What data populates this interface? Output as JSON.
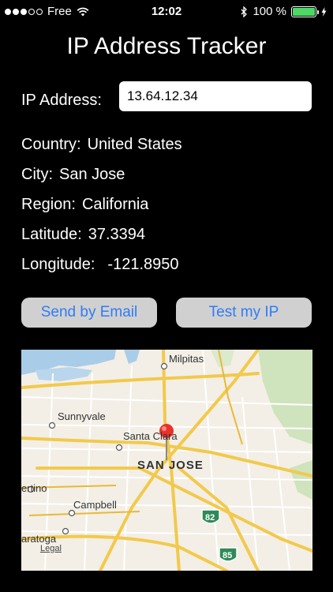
{
  "status_bar": {
    "carrier": "Free",
    "time": "12:02",
    "battery_percent": "100 %",
    "battery_level": 1.0,
    "icons": [
      "signal-dots",
      "wifi-icon",
      "bluetooth-icon",
      "battery-icon",
      "charging-bolt-icon"
    ]
  },
  "app": {
    "title": "IP Address Tracker"
  },
  "ip": {
    "label": "IP Address:",
    "value": "13.64.12.34"
  },
  "info": {
    "country_label": "Country:",
    "country": "United States",
    "city_label": "City:",
    "city": "San Jose",
    "region_label": "Region:",
    "region": "California",
    "latitude_label": "Latitude:",
    "latitude": "37.3394",
    "longitude_label": "Longitude:",
    "longitude": "-121.8950"
  },
  "buttons": {
    "email": "Send by Email",
    "test": "Test my IP"
  },
  "colors": {
    "button_text": "#2f7cf6",
    "button_bg": "#d0d0d0",
    "battery": "#4cd964",
    "pin": "#e8312c"
  },
  "map": {
    "places": {
      "milpitas": "Milpitas",
      "sunnyvale": "Sunnyvale",
      "santa_clara": "Santa Clara",
      "san_jose": "SAN JOSE",
      "cupertino": "ertino",
      "campbell": "Campbell",
      "saratoga": "aratoga",
      "legal": "Legal"
    },
    "shields": {
      "route82": "82",
      "route85": "85"
    }
  }
}
